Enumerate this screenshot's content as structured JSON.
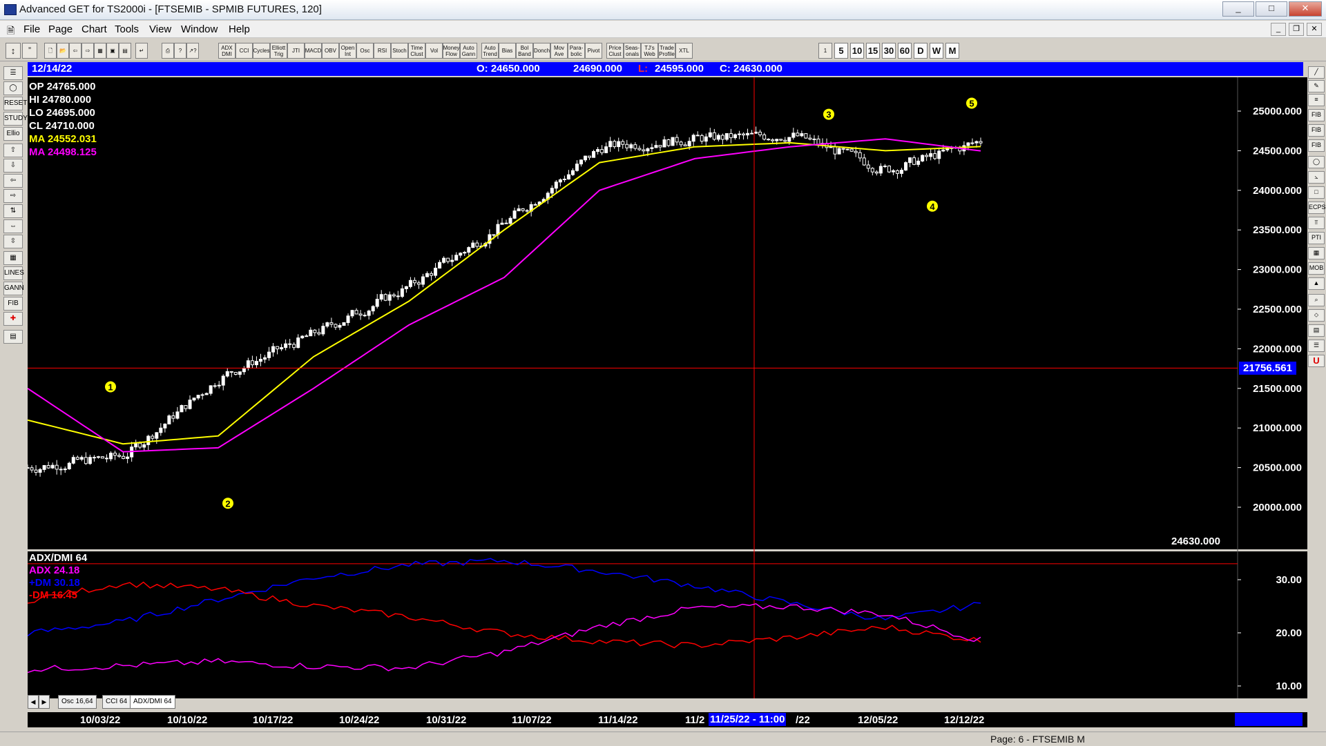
{
  "window": {
    "title": "Advanced GET for TS2000i - [FTSEMIB - SPMIB FUTURES, 120]",
    "min": "_",
    "max": "□",
    "close": "✕"
  },
  "menu": [
    "File",
    "Page",
    "Chart",
    "Tools",
    "View",
    "Window",
    "Help"
  ],
  "toolbar": {
    "studies": [
      "ADX DMI",
      "CCI",
      "Cycles",
      "Elliott Trig",
      "JTI",
      "MACD",
      "OBV",
      "Open Int",
      "Osc",
      "RSI",
      "Stoch",
      "Time Clust",
      "Vol",
      "Money Flow",
      "Auto Gann",
      "Auto Trend",
      "Bias",
      "Bol Band",
      "Donch",
      "Mov Ave",
      "Para-bolic",
      "Pivot",
      "Price Clust",
      "Seas-onals",
      "TJ's Web",
      "Trade Profile",
      "XTL"
    ],
    "intervals": [
      "1",
      "5",
      "10",
      "15",
      "30",
      "60",
      "D",
      "W",
      "M"
    ]
  },
  "info_bar": {
    "date": "12/14/22",
    "open": "O: 24650.000",
    "high": "24690.000",
    "low_label": "L:",
    "low": "24595.000",
    "close": "C: 24630.000"
  },
  "ohlc_panel": {
    "op": "OP  24765.000",
    "hi": "HI   24780.000",
    "lo": "LO  24695.000",
    "cl": "CL  24710.000",
    "ma1": "MA  24552.031",
    "ma2": "MA  24498.125"
  },
  "price_axis": [
    "25000.000",
    "24500.000",
    "24000.000",
    "23500.000",
    "23000.000",
    "22500.000",
    "22000.000",
    "21500.000",
    "21000.000",
    "20500.000",
    "20000.000"
  ],
  "cursor_price": "21756.561",
  "last_price": "24630.000",
  "indicator": {
    "title": "ADX/DMI 64",
    "adx": "ADX 24.18",
    "pdm": "+DM 30.18",
    "mdm": "-DM  16.45",
    "axis": [
      "30.00",
      "20.00",
      "10.00"
    ]
  },
  "tabs": [
    "Osc 16,64",
    "CCI 64",
    "ADX/DMI 64"
  ],
  "dates": [
    "10/03/22",
    "10/10/22",
    "10/17/22",
    "10/24/22",
    "10/31/22",
    "11/07/22",
    "11/14/22",
    "11/2",
    "/22",
    "12/05/22",
    "12/12/22"
  ],
  "cursor_date": "11/25/22 - 11:00",
  "status": "Page: 6 - FTSEMIB M",
  "colors": {
    "bg": "#000000",
    "candle": "#ffffff",
    "ma_fast": "#ffff00",
    "ma_slow": "#ff00ff",
    "pdm": "#0000ff",
    "mdm": "#ff0000",
    "adx": "#ff00ff",
    "cursor": "#ff0000",
    "accent": "#0000ff"
  },
  "chart_data": {
    "type": "line",
    "title": "FTSEMIB - SPMIB FUTURES, 120",
    "xlabel": "",
    "ylabel": "",
    "ylim": [
      19600,
      25400
    ],
    "x": [
      "10/03/22",
      "10/10/22",
      "10/17/22",
      "10/24/22",
      "10/31/22",
      "11/07/22",
      "11/14/22",
      "11/21/22",
      "11/28/22",
      "12/05/22",
      "12/12/22"
    ],
    "series": [
      {
        "name": "Price",
        "values": [
          20500,
          20650,
          21650,
          22200,
          22800,
          23600,
          24550,
          24650,
          24700,
          24250,
          24630
        ]
      },
      {
        "name": "MA 24552.031",
        "values": [
          21100,
          20800,
          20900,
          21900,
          22600,
          23500,
          24350,
          24550,
          24600,
          24500,
          24552
        ]
      },
      {
        "name": "MA 24498.125",
        "values": [
          21500,
          20700,
          20750,
          21500,
          22300,
          22900,
          24000,
          24400,
          24550,
          24650,
          24498
        ]
      }
    ],
    "waves": [
      {
        "label": "1",
        "x": "10/04/22",
        "price": 21520
      },
      {
        "label": "2",
        "x": "10/13/22",
        "price": 20050
      },
      {
        "label": "3",
        "x": "11/22/22",
        "price": 24960
      },
      {
        "label": "4",
        "x": "12/07/22",
        "price": 23800
      },
      {
        "label": "5",
        "x": "12/13/22",
        "price": 25100
      }
    ]
  }
}
